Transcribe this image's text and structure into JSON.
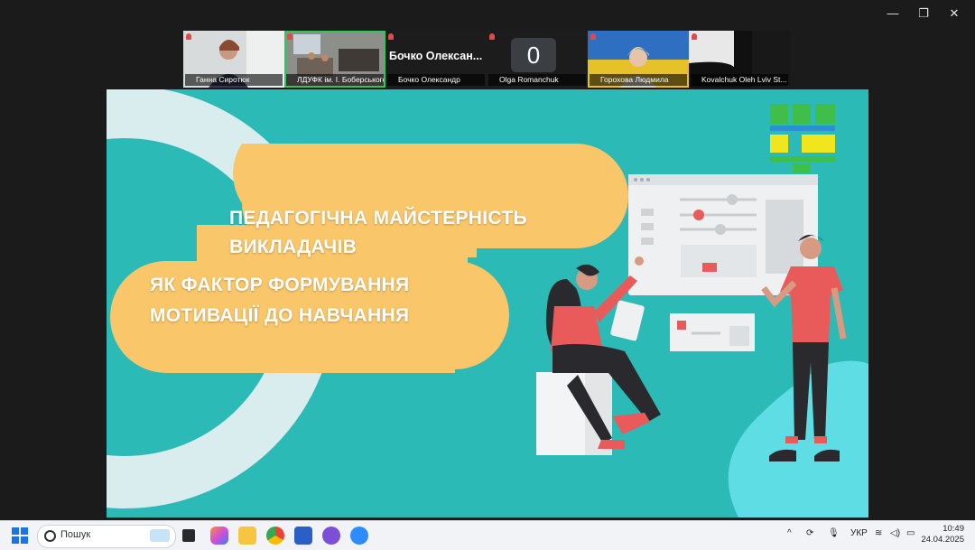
{
  "window": {
    "minimize": "—",
    "restore": "❐",
    "close": "✕"
  },
  "participants": [
    {
      "name": "Ганна Сиротюк"
    },
    {
      "name": "ЛДУФК ім. І. Боберського..."
    },
    {
      "name": "Бочко Олександр",
      "display": "Бочко  Олексан..."
    },
    {
      "name": "Olga Romanchuk",
      "display": "0"
    },
    {
      "name": "Горохова Людмила"
    },
    {
      "name": "Kovalchuk Oleh Lviv St..."
    }
  ],
  "slide": {
    "title_line1": "ПЕДАГОГІЧНА МАЙСТЕРНІСТЬ",
    "title_line2": "ВИКЛАДАЧІВ",
    "title_line3": "ЯК ФАКТОР ФОРМУВАННЯ",
    "title_line4": "МОТИВАЦІЇ ДО НАВЧАННЯ"
  },
  "taskbar": {
    "search_placeholder": "Пошук",
    "language": "УКР",
    "time": "10:49",
    "date": "24.04.2025"
  },
  "colors": {
    "slide_bg": "#2cbab7",
    "blob": "#f9c66a",
    "accent": "#e95a5a"
  }
}
